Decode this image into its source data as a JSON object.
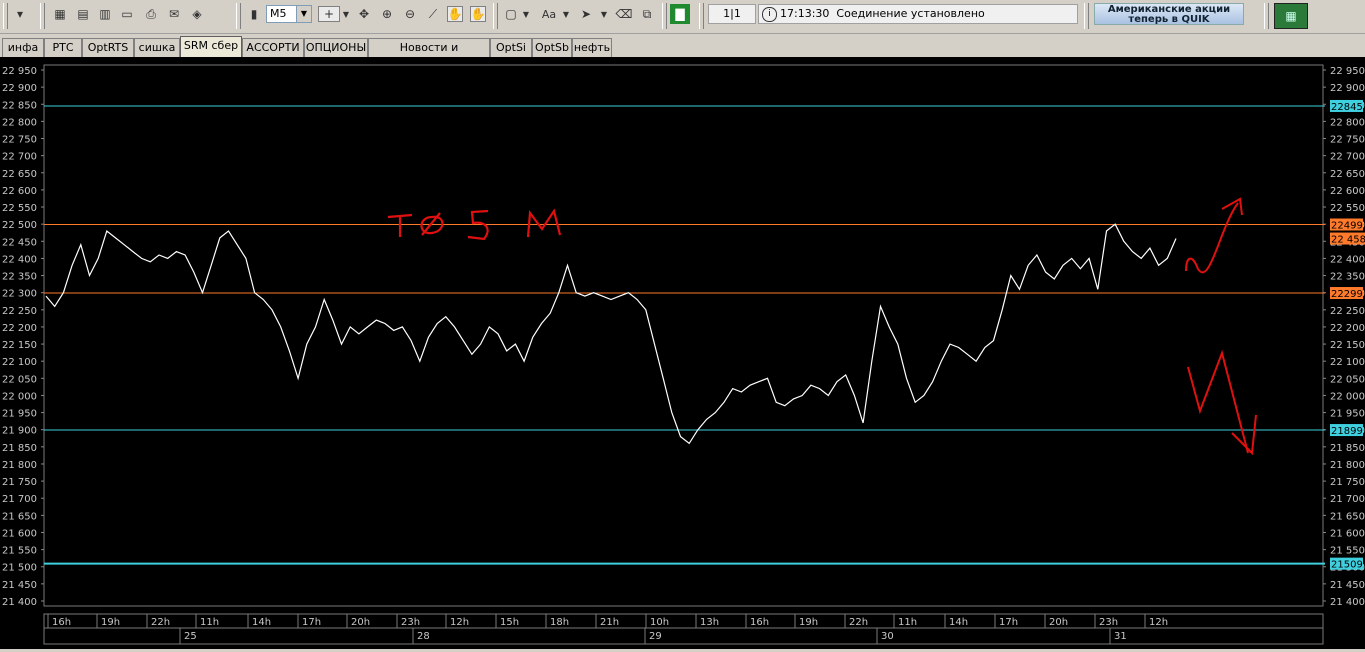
{
  "toolbar": {
    "timeframe": "M5",
    "font_label": "Aa",
    "page_counter": "1|1",
    "clock": "17:13:30",
    "connection_status": "Соединение установлено",
    "banner_line1": "Американские акции",
    "banner_line2": "теперь в QUIK"
  },
  "tabs": [
    {
      "label": "инфа"
    },
    {
      "label": "РТС"
    },
    {
      "label": "OptRTS"
    },
    {
      "label": "сишка"
    },
    {
      "label": "SRM сбер",
      "active": true
    },
    {
      "label": "АССОРТИ"
    },
    {
      "label": "ОПЦИОНЫ"
    },
    {
      "label": "Новости и сообщения"
    },
    {
      "label": "OptSi"
    },
    {
      "label": "OptSb"
    },
    {
      "label": "нефть"
    }
  ],
  "chart_data": {
    "type": "line",
    "annotation_text": "ТФ 5М",
    "y_ticks": [
      "22 950",
      "22 900",
      "22 850",
      "22 800",
      "22 750",
      "22 700",
      "22 650",
      "22 600",
      "22 550",
      "22 500",
      "22 450",
      "22 400",
      "22 350",
      "22 300",
      "22 250",
      "22 200",
      "22 150",
      "22 100",
      "22 050",
      "22 000",
      "21 950",
      "21 900",
      "21 850",
      "21 800",
      "21 750",
      "21 700",
      "21 650",
      "21 600",
      "21 550",
      "21 500",
      "21 450",
      "21 400"
    ],
    "ylim": [
      21400,
      22950
    ],
    "hour_labels": [
      "16h",
      "19h",
      "22h",
      "11h",
      "14h",
      "17h",
      "20h",
      "23h",
      "12h",
      "15h",
      "18h",
      "21h",
      "10h",
      "13h",
      "16h",
      "19h",
      "22h",
      "11h",
      "14h",
      "17h",
      "20h",
      "23h",
      "12h"
    ],
    "day_labels": [
      "25",
      "28",
      "29",
      "30",
      "31"
    ],
    "levels": [
      {
        "value": 22845,
        "label": "22845",
        "color": "#3fd0e0"
      },
      {
        "value": 22499,
        "label": "22499",
        "color": "#ff7a2a"
      },
      {
        "value": 22299,
        "label": "22299",
        "color": "#ff7a2a"
      },
      {
        "value": 21899,
        "label": "21899",
        "color": "#3fd0e0"
      },
      {
        "value": 21509,
        "label": "21509",
        "color": "#3fd0e0"
      }
    ],
    "last_price": {
      "value": 22458,
      "label": "22 458",
      "color": "#ff7a2a"
    },
    "series": [
      {
        "values": [
          22290,
          22260,
          22300,
          22380,
          22440,
          22350,
          22400,
          22480,
          22460,
          22440,
          22420,
          22400,
          22390,
          22410,
          22400,
          22420,
          22410,
          22360,
          22300,
          22380,
          22460,
          22480,
          22440,
          22400,
          22300,
          22280,
          22250,
          22200,
          22130,
          22050,
          22150,
          22200,
          22280,
          22220,
          22150,
          22200,
          22180,
          22200,
          22220,
          22210,
          22190,
          22200,
          22160,
          22100,
          22170,
          22210,
          22230,
          22200,
          22160,
          22120,
          22150,
          22200,
          22180,
          22130,
          22150,
          22100,
          22170,
          22210,
          22240,
          22300,
          22380,
          22300,
          22290,
          22300,
          22290,
          22280,
          22290,
          22300,
          22280,
          22250,
          22150,
          22050,
          21950,
          21880,
          21860,
          21900,
          21930,
          21950,
          21980,
          22020,
          22010,
          22030,
          22040,
          22050,
          21980,
          21970,
          21990,
          22000,
          22030,
          22020,
          22000,
          22040,
          22060,
          22000,
          21920,
          22100,
          22260,
          22200,
          22150,
          22050,
          21980,
          22000,
          22040,
          22100,
          22150,
          22140,
          22120,
          22100,
          22140,
          22160,
          22250,
          22350,
          22310,
          22380,
          22410,
          22360,
          22340,
          22380,
          22400,
          22370,
          22400,
          22310,
          22480,
          22500,
          22450,
          22420,
          22400,
          22430,
          22380,
          22400,
          22458
        ]
      }
    ]
  }
}
